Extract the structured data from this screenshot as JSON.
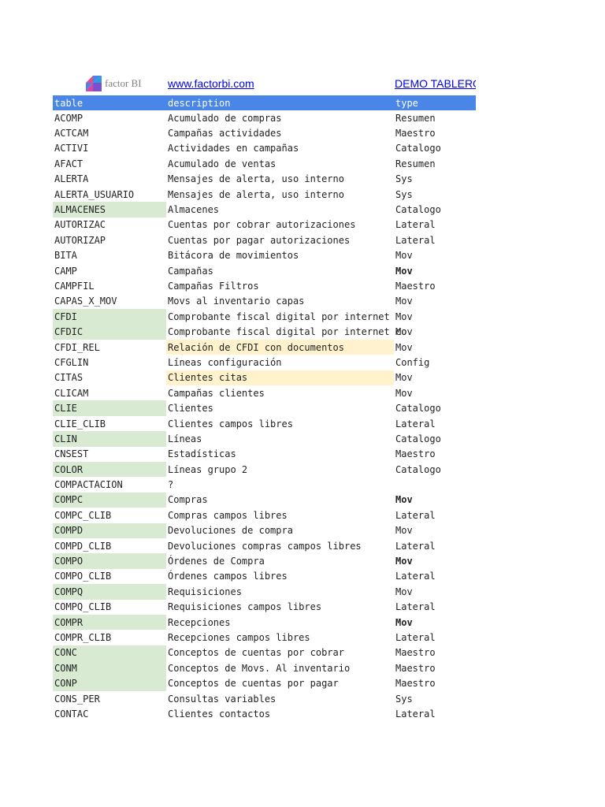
{
  "header": {
    "logo_text": "factor BI",
    "site_link": "www.factorbi.com",
    "demo_link": "DEMO TABLERO"
  },
  "colors": {
    "header_bg": "#4a86e8",
    "green_highlight": "#d9ead3",
    "yellow_highlight": "#fff2cc"
  },
  "table": {
    "columns": [
      "table",
      "description",
      "type"
    ],
    "rows": [
      {
        "table": "ACOMP",
        "description": "Acumulado de compras",
        "type": "Resumen"
      },
      {
        "table": "ACTCAM",
        "description": "Campañas actividades",
        "type": "Maestro"
      },
      {
        "table": "ACTIVI",
        "description": "Actividades en campañas",
        "type": "Catalogo"
      },
      {
        "table": "AFACT",
        "description": "Acumulado de ventas",
        "type": "Resumen"
      },
      {
        "table": "ALERTA",
        "description": "Mensajes de alerta, uso interno",
        "type": "Sys"
      },
      {
        "table": "ALERTA_USUARIO",
        "description": "Mensajes de alerta, uso interno",
        "type": "Sys"
      },
      {
        "table": "ALMACENES",
        "description": "Almacenes",
        "type": "Catalogo",
        "hl": "g"
      },
      {
        "table": "AUTORIZAC",
        "description": "Cuentas por cobrar autorizaciones",
        "type": "Lateral"
      },
      {
        "table": "AUTORIZAP",
        "description": "Cuentas por pagar autorizaciones",
        "type": "Lateral"
      },
      {
        "table": "BITA",
        "description": "Bitácora de movimientos",
        "type": "Mov"
      },
      {
        "table": "CAMP",
        "description": "Campañas",
        "type": "Mov",
        "bold": true
      },
      {
        "table": "CAMPFIL",
        "description": "Campañas Filtros",
        "type": "Maestro"
      },
      {
        "table": "CAPAS_X_MOV",
        "description": "Movs al inventario capas",
        "type": "Mov"
      },
      {
        "table": "CFDI",
        "description": "Comprobante fiscal digital por internet",
        "type": "Mov",
        "hl": "g"
      },
      {
        "table": "CFDIC",
        "description": "Comprobante fiscal digital por internet co",
        "type": "Mov",
        "hl": "g"
      },
      {
        "table": "CFDI_REL",
        "description": "Relación de CFDI con documentos",
        "type": "Mov",
        "hl2": "y"
      },
      {
        "table": "CFGLIN",
        "description": "Líneas configuración",
        "type": "Config"
      },
      {
        "table": "CITAS",
        "description": "Clientes citas",
        "type": "Mov",
        "hl2": "y"
      },
      {
        "table": "CLICAM",
        "description": "Campañas clientes",
        "type": "Mov"
      },
      {
        "table": "CLIE",
        "description": "Clientes",
        "type": "Catalogo",
        "hl": "g"
      },
      {
        "table": "CLIE_CLIB",
        "description": "Clientes campos libres",
        "type": "Lateral"
      },
      {
        "table": "CLIN",
        "description": "Líneas",
        "type": "Catalogo",
        "hl": "g"
      },
      {
        "table": "CNSEST",
        "description": "Estadísticas",
        "type": "Maestro"
      },
      {
        "table": "COLOR",
        "description": "Líneas grupo 2",
        "type": "Catalogo",
        "hl": "g"
      },
      {
        "table": "COMPACTACION",
        "description": "?",
        "type": ""
      },
      {
        "table": "COMPC",
        "description": "Compras",
        "type": "Mov",
        "hl": "g",
        "bold": true
      },
      {
        "table": "COMPC_CLIB",
        "description": "Compras campos libres",
        "type": "Lateral"
      },
      {
        "table": "COMPD",
        "description": "Devoluciones de compra",
        "type": "Mov",
        "hl": "g"
      },
      {
        "table": "COMPD_CLIB",
        "description": "Devoluciones compras campos libres",
        "type": "Lateral"
      },
      {
        "table": "COMPO",
        "description": "Órdenes de Compra",
        "type": "Mov",
        "hl": "g",
        "bold": true
      },
      {
        "table": "COMPO_CLIB",
        "description": "Órdenes campos libres",
        "type": "Lateral"
      },
      {
        "table": "COMPQ",
        "description": "Requisiciones",
        "type": "Mov",
        "hl": "g"
      },
      {
        "table": "COMPQ_CLIB",
        "description": "Requisiciones campos libres",
        "type": "Lateral"
      },
      {
        "table": "COMPR",
        "description": "Recepciones",
        "type": "Mov",
        "hl": "g",
        "bold": true
      },
      {
        "table": "COMPR_CLIB",
        "description": "Recepciones campos libres",
        "type": "Lateral"
      },
      {
        "table": "CONC",
        "description": "Conceptos de cuentas por cobrar",
        "type": "Maestro",
        "hl": "g"
      },
      {
        "table": "CONM",
        "description": "Conceptos de Movs. Al inventario",
        "type": "Maestro",
        "hl": "g"
      },
      {
        "table": "CONP",
        "description": "Conceptos de cuentas por pagar",
        "type": "Maestro",
        "hl": "g"
      },
      {
        "table": "CONS_PER",
        "description": "Consultas variables",
        "type": "Sys"
      },
      {
        "table": "CONTAC",
        "description": "Clientes contactos",
        "type": "Lateral"
      }
    ]
  }
}
